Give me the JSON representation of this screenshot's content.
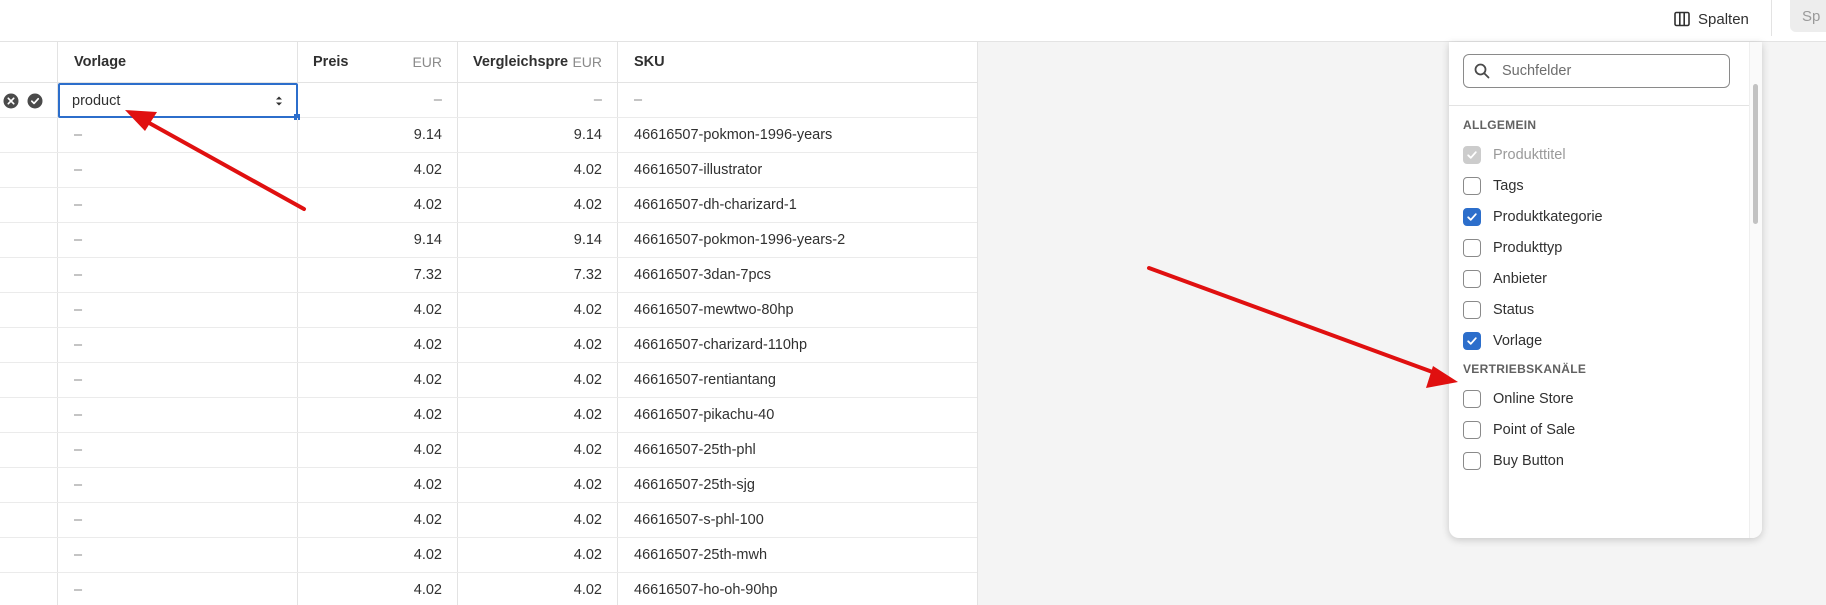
{
  "toolbar": {
    "columns_label": "Spalten",
    "clipped_button_label": "Sp"
  },
  "table": {
    "headers": {
      "template": "Vorlage",
      "price": "Preis",
      "price_unit": "EUR",
      "compare_price": "Vergleichspre",
      "compare_price_unit": "EUR",
      "sku": "SKU"
    },
    "edit_row": {
      "template_value": "product",
      "price": "–",
      "compare_price": "–",
      "sku": "–"
    },
    "rows": [
      {
        "template": "–",
        "price": "9.14",
        "compare_price": "9.14",
        "sku": "46616507-pokmon-1996-years"
      },
      {
        "template": "–",
        "price": "4.02",
        "compare_price": "4.02",
        "sku": "46616507-illustrator"
      },
      {
        "template": "–",
        "price": "4.02",
        "compare_price": "4.02",
        "sku": "46616507-dh-charizard-1"
      },
      {
        "template": "–",
        "price": "9.14",
        "compare_price": "9.14",
        "sku": "46616507-pokmon-1996-years-2"
      },
      {
        "template": "–",
        "price": "7.32",
        "compare_price": "7.32",
        "sku": "46616507-3dan-7pcs"
      },
      {
        "template": "–",
        "price": "4.02",
        "compare_price": "4.02",
        "sku": "46616507-mewtwo-80hp"
      },
      {
        "template": "–",
        "price": "4.02",
        "compare_price": "4.02",
        "sku": "46616507-charizard-110hp"
      },
      {
        "template": "–",
        "price": "4.02",
        "compare_price": "4.02",
        "sku": "46616507-rentiantang"
      },
      {
        "template": "–",
        "price": "4.02",
        "compare_price": "4.02",
        "sku": "46616507-pikachu-40"
      },
      {
        "template": "–",
        "price": "4.02",
        "compare_price": "4.02",
        "sku": "46616507-25th-phl"
      },
      {
        "template": "–",
        "price": "4.02",
        "compare_price": "4.02",
        "sku": "46616507-25th-sjg"
      },
      {
        "template": "–",
        "price": "4.02",
        "compare_price": "4.02",
        "sku": "46616507-s-phl-100"
      },
      {
        "template": "–",
        "price": "4.02",
        "compare_price": "4.02",
        "sku": "46616507-25th-mwh"
      },
      {
        "template": "–",
        "price": "4.02",
        "compare_price": "4.02",
        "sku": "46616507-ho-oh-90hp"
      }
    ]
  },
  "columns_panel": {
    "search_placeholder": "Suchfelder",
    "sections": [
      {
        "title": "ALLGEMEIN",
        "options": [
          {
            "label": "Produkttitel",
            "checked": true,
            "disabled": true
          },
          {
            "label": "Tags",
            "checked": false,
            "disabled": false
          },
          {
            "label": "Produktkategorie",
            "checked": true,
            "disabled": false
          },
          {
            "label": "Produkttyp",
            "checked": false,
            "disabled": false
          },
          {
            "label": "Anbieter",
            "checked": false,
            "disabled": false
          },
          {
            "label": "Status",
            "checked": false,
            "disabled": false
          },
          {
            "label": "Vorlage",
            "checked": true,
            "disabled": false
          }
        ]
      },
      {
        "title": "VERTRIEBSKANÄLE",
        "options": [
          {
            "label": "Online Store",
            "checked": false,
            "disabled": false
          },
          {
            "label": "Point of Sale",
            "checked": false,
            "disabled": false
          },
          {
            "label": "Buy Button",
            "checked": false,
            "disabled": false
          }
        ]
      }
    ]
  },
  "colors": {
    "accent": "#2c6ecb",
    "annotation_arrow": "#e01010"
  }
}
